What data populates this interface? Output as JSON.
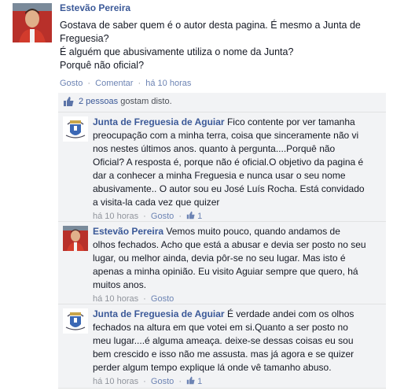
{
  "post": {
    "author": "Estevão Pereira",
    "text_lines": [
      "Gostava de saber quem é o autor desta pagina. É mesmo a Junta de",
      "Freguesia?",
      "É alguém que abusivamente utiliza o nome da Junta?",
      "Porquê não oficial?"
    ],
    "actions": {
      "like": "Gosto",
      "sep": "·",
      "comment": "Comentar",
      "time": "há 10 horas"
    }
  },
  "likes": {
    "count_link": "2 pessoas",
    "suffix": " gostam disto."
  },
  "comments": [
    {
      "author": "Junta de Freguesia de Aguiar",
      "lines": [
        " Fico contente por ver tamanha",
        "preocupação com a minha terra, coisa que sinceramente não vi",
        "nos nestes últimos anos. quanto à pergunta....Porquê não",
        "Oficial? A resposta é, porque não é oficial.O objetivo da pagina é",
        "dar a conhecer a minha Freguesia e nunca usar o seu nome",
        "abusivamente.. O autor sou eu José Luís Rocha. Está convidado",
        "a visita-la cada vez que quizer"
      ],
      "time": "há 10 horas",
      "sep": "·",
      "like": "Gosto",
      "like_count": "1"
    },
    {
      "author": "Estevão Pereira",
      "lines": [
        " Vemos muito pouco, quando andamos de",
        "olhos fechados. Acho que está a abusar e devia ser posto no seu",
        "lugar, ou melhor ainda, devia pôr-se no seu lugar. Mas isto é",
        "apenas a minha opinião. Eu visito Aguiar sempre que quero, há",
        "muitos anos."
      ],
      "time": "há 10 horas",
      "sep": "·",
      "like": "Gosto",
      "like_count": ""
    },
    {
      "author": "Junta de Freguesia de Aguiar",
      "lines": [
        " É verdade andei com os olhos",
        "fechados na altura em que votei em si.Quanto a ser posto no",
        "meu lugar....é alguma ameaça. deixe-se dessas coisas eu sou",
        "bem crescido e isso não me assusta. mas já agora e se quizer",
        "perder algum tempo explique lá onde vê tamanho abuso."
      ],
      "time": "há 10 horas",
      "sep": "·",
      "like": "Gosto",
      "like_count": "1"
    }
  ],
  "colors": {
    "link": "#3b5998",
    "meta": "#90949c",
    "comment_bg": "#f2f3f5"
  }
}
